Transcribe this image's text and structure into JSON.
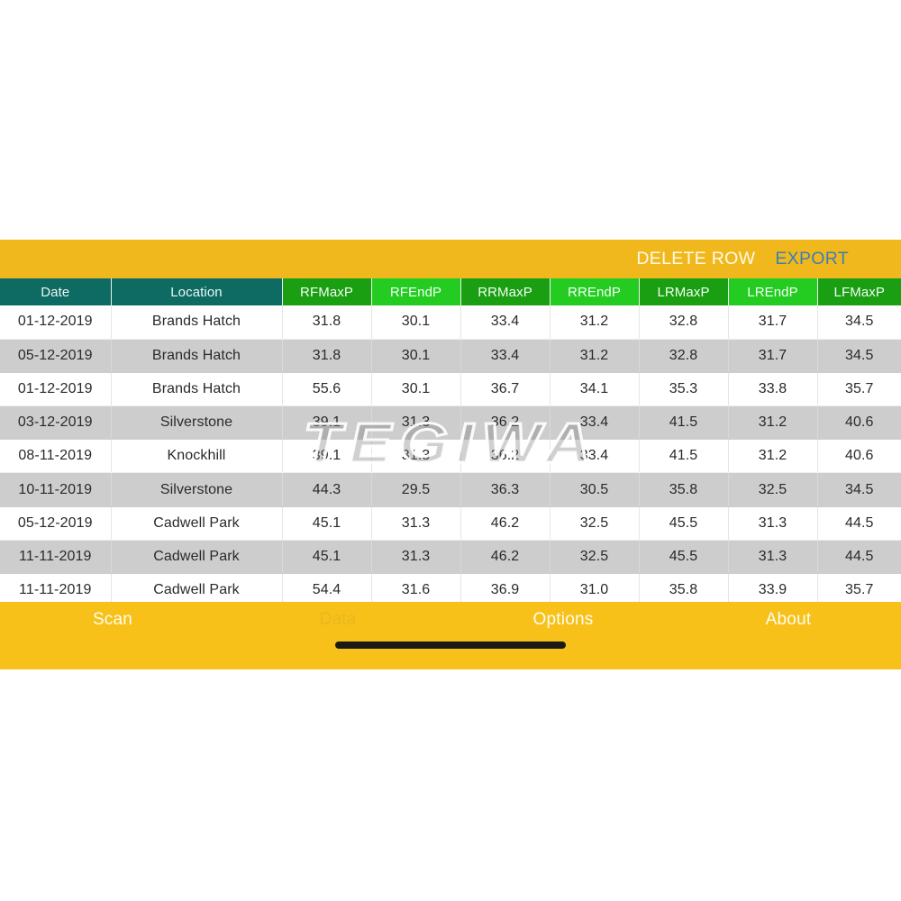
{
  "theme": {
    "accent_yellow": "#f7c11a",
    "action_bar_yellow": "#f0b81c",
    "header_teal": "#0e6b63",
    "header_green_dark": "#1a9e12",
    "header_green_light": "#24cc22",
    "export_blue": "#3d7fb5",
    "row_alt_grey": "#cdcdcd"
  },
  "watermark": {
    "text": "TEGIWA"
  },
  "action_bar": {
    "delete_row_label": "DELETE ROW",
    "export_label": "EXPORT"
  },
  "table": {
    "columns": [
      "Date",
      "Location",
      "RFMaxP",
      "RFEndP",
      "RRMaxP",
      "RREndP",
      "LRMaxP",
      "LREndP",
      "LFMaxP"
    ],
    "rows": [
      [
        "01-12-2019",
        "Brands Hatch",
        "31.8",
        "30.1",
        "33.4",
        "31.2",
        "32.8",
        "31.7",
        "34.5"
      ],
      [
        "05-12-2019",
        "Brands Hatch",
        "31.8",
        "30.1",
        "33.4",
        "31.2",
        "32.8",
        "31.7",
        "34.5"
      ],
      [
        "01-12-2019",
        "Brands Hatch",
        "55.6",
        "30.1",
        "36.7",
        "34.1",
        "35.3",
        "33.8",
        "35.7"
      ],
      [
        "03-12-2019",
        "Silverstone",
        "39.1",
        "31.3",
        "36.2",
        "33.4",
        "41.5",
        "31.2",
        "40.6"
      ],
      [
        "08-11-2019",
        "Knockhill",
        "39.1",
        "31.3",
        "36.2",
        "33.4",
        "41.5",
        "31.2",
        "40.6"
      ],
      [
        "10-11-2019",
        "Silverstone",
        "44.3",
        "29.5",
        "36.3",
        "30.5",
        "35.8",
        "32.5",
        "34.5"
      ],
      [
        "05-12-2019",
        "Cadwell Park",
        "45.1",
        "31.3",
        "46.2",
        "32.5",
        "45.5",
        "31.3",
        "44.5"
      ],
      [
        "11-11-2019",
        "Cadwell Park",
        "45.1",
        "31.3",
        "46.2",
        "32.5",
        "45.5",
        "31.3",
        "44.5"
      ],
      [
        "11-11-2019",
        "Cadwell Park",
        "54.4",
        "31.6",
        "36.9",
        "31.0",
        "35.8",
        "33.9",
        "35.7"
      ]
    ]
  },
  "tab_bar": {
    "tabs": [
      {
        "label": "Scan",
        "state": "normal"
      },
      {
        "label": "Data",
        "state": "dim"
      },
      {
        "label": "Options",
        "state": "normal"
      },
      {
        "label": "About",
        "state": "normal"
      }
    ]
  }
}
